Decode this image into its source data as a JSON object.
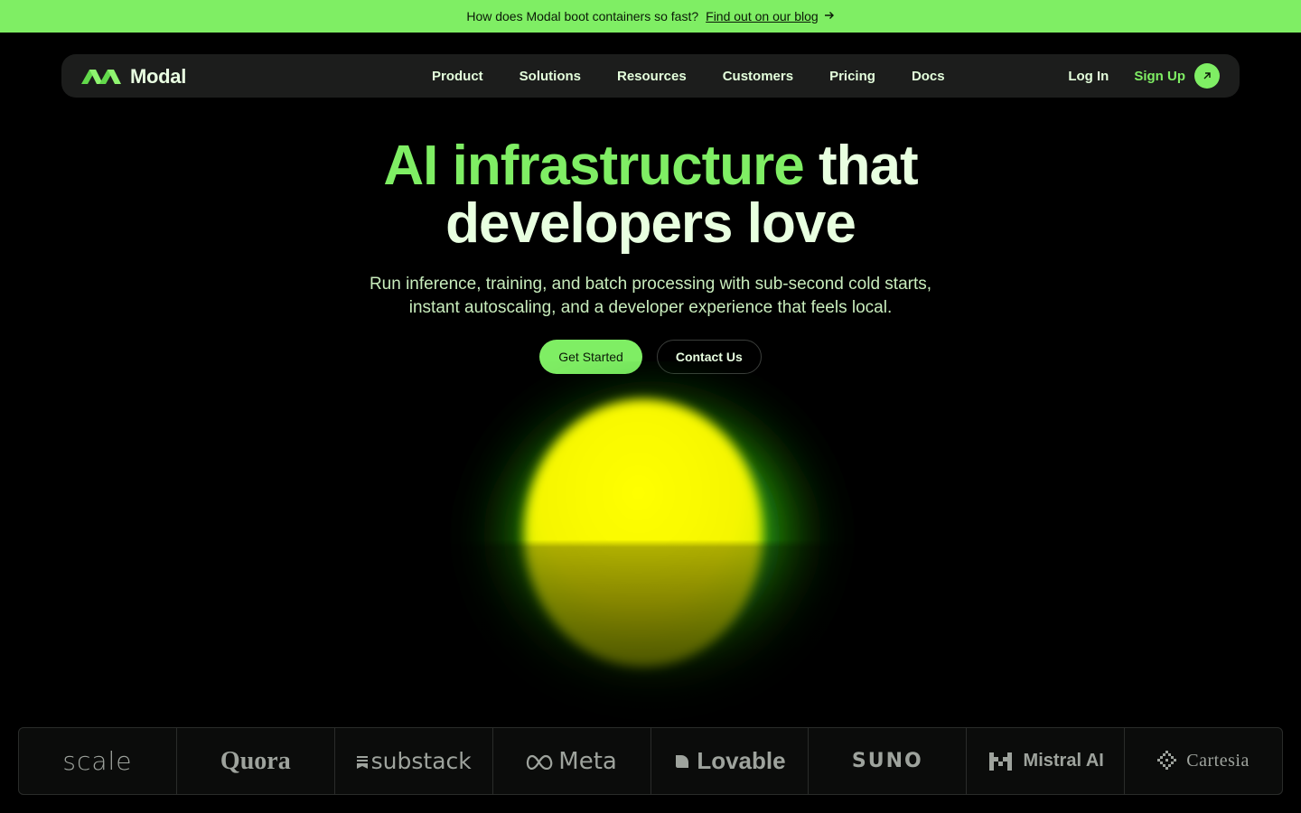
{
  "banner": {
    "text": "How does Modal boot containers so fast?",
    "link": "Find out on our blog",
    "arrow_icon": "arrow-right-icon"
  },
  "nav": {
    "brand": "Modal",
    "items": [
      {
        "label": "Product"
      },
      {
        "label": "Solutions"
      },
      {
        "label": "Resources"
      },
      {
        "label": "Customers"
      },
      {
        "label": "Pricing"
      },
      {
        "label": "Docs"
      }
    ],
    "login": "Log In",
    "signup": "Sign Up"
  },
  "hero": {
    "title_accent": "AI infrastructure",
    "title_rest_line1": " that",
    "title_line2": "developers love",
    "subtitle": "Run inference, training, and batch processing with sub-second cold starts, instant autoscaling, and a developer experience that feels local.",
    "primary_cta": "Get Started",
    "secondary_cta": "Contact Us"
  },
  "customers": [
    {
      "name": "scale"
    },
    {
      "name": "Quora"
    },
    {
      "name": "substack"
    },
    {
      "name": "Meta"
    },
    {
      "name": "Lovable"
    },
    {
      "name": "SUNO"
    },
    {
      "name": "Mistral AI"
    },
    {
      "name": "Cartesia"
    }
  ],
  "colors": {
    "accent": "#7fee64",
    "background": "#000000",
    "nav_bg": "#1c1d1c",
    "text": "#e8ffe0"
  }
}
